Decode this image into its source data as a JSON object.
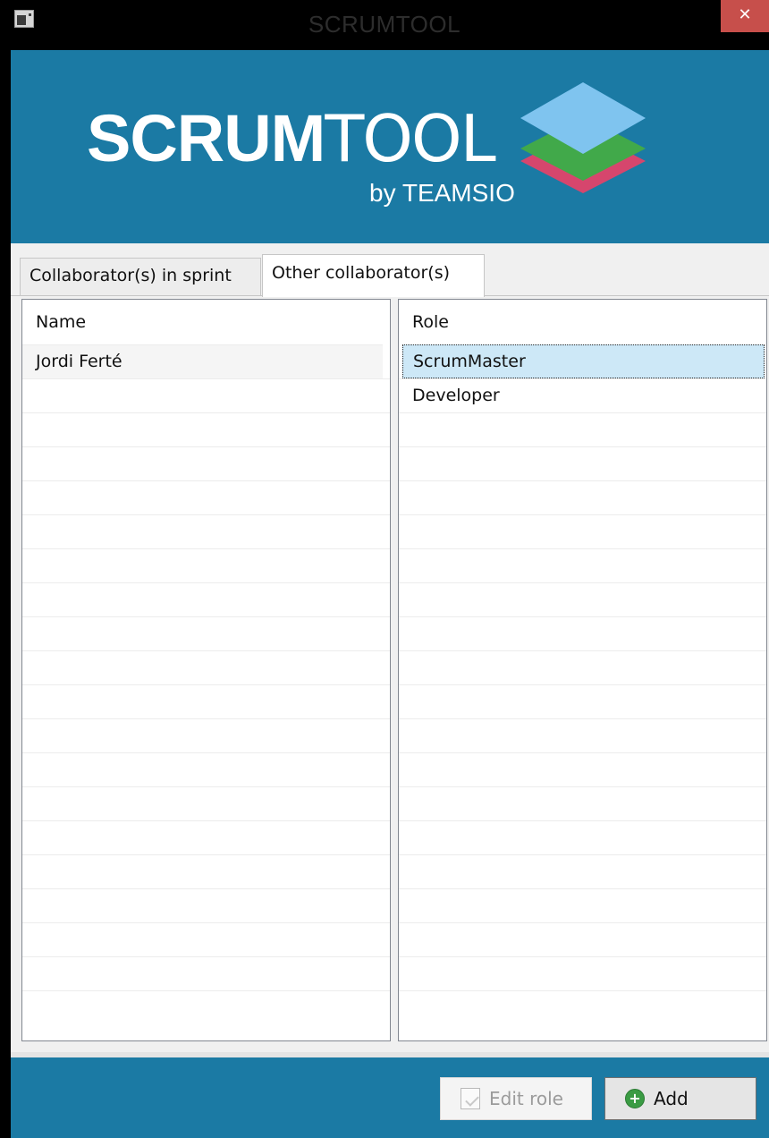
{
  "window": {
    "title": "SCRUMTOOL",
    "close_glyph": "✕"
  },
  "banner": {
    "logo_part1": "SCRUM",
    "logo_part2": "TOOL",
    "logo_byline": "by TEAMSIO",
    "layer_colors": [
      "#7fc4ef",
      "#41a94a",
      "#d6466d"
    ]
  },
  "tabs": [
    {
      "label": "Collaborator(s) in sprint",
      "active": false
    },
    {
      "label": "Other collaborator(s)",
      "active": true
    }
  ],
  "left_list": {
    "header": "Name",
    "rows": [
      "Jordi Ferté"
    ]
  },
  "right_list": {
    "header": "Role",
    "rows": [
      "ScrumMaster",
      "Developer"
    ],
    "selected": "ScrumMaster"
  },
  "footer": {
    "edit_label": "Edit role",
    "edit_enabled": false,
    "add_label": "Add",
    "add_icon_glyph": "+"
  }
}
